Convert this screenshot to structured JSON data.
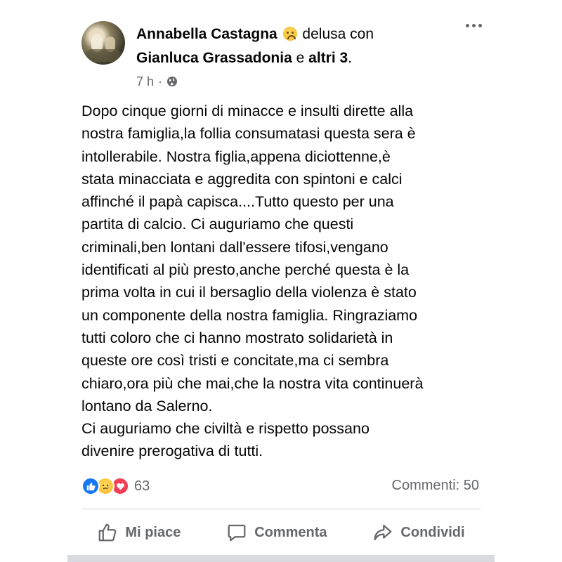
{
  "post": {
    "author": "Annabella Castagna",
    "feeling": "delusa con",
    "tagged_person": "Gianluca Grassadonia",
    "conjunction": "e",
    "others": "altri 3",
    "period": ".",
    "time": "7 h",
    "dot": "·",
    "body_lines": [
      "Dopo cinque giorni di minacce e insulti dirette alla",
      "nostra famiglia,la follia consumatasi questa sera è",
      "intollerabile. Nostra figlia,appena diciottenne,è",
      "stata minacciata e aggredita con spintoni e calci",
      "affinché il papà capisca....Tutto questo per una",
      "partita di calcio. Ci auguriamo che questi",
      "criminali,ben lontani dall'essere tifosi,vengano",
      "identificati al più presto,anche perché questa è la",
      "prima volta in cui il bersaglio della violenza è stato",
      "un componente della nostra famiglia. Ringraziamo",
      "tutti coloro che ci hanno mostrato solidarietà in",
      "queste ore così tristi e concitate,ma ci sembra",
      "chiaro,ora più che mai,che la nostra vita continuerà",
      "lontano da Salerno.",
      "Ci auguriamo che civiltà e rispetto possano",
      "divenire prerogativa di tutti."
    ]
  },
  "stats": {
    "reaction_count": "63",
    "comments": "Commenti: 50"
  },
  "actions": {
    "like": "Mi piace",
    "comment": "Commenta",
    "share": "Condividi"
  },
  "colors": {
    "like_blue": "#1877f2",
    "love_red": "#f33e58",
    "secondary_text": "#65676b"
  },
  "icons": {
    "header": [
      "sad-emoji-icon",
      "globe-icon",
      "more-options-icon"
    ],
    "reactions": [
      "like-reaction-icon",
      "sad-reaction-icon",
      "love-reaction-icon"
    ],
    "actions": [
      "thumbs-up-icon",
      "comment-bubble-icon",
      "share-arrow-icon"
    ]
  }
}
